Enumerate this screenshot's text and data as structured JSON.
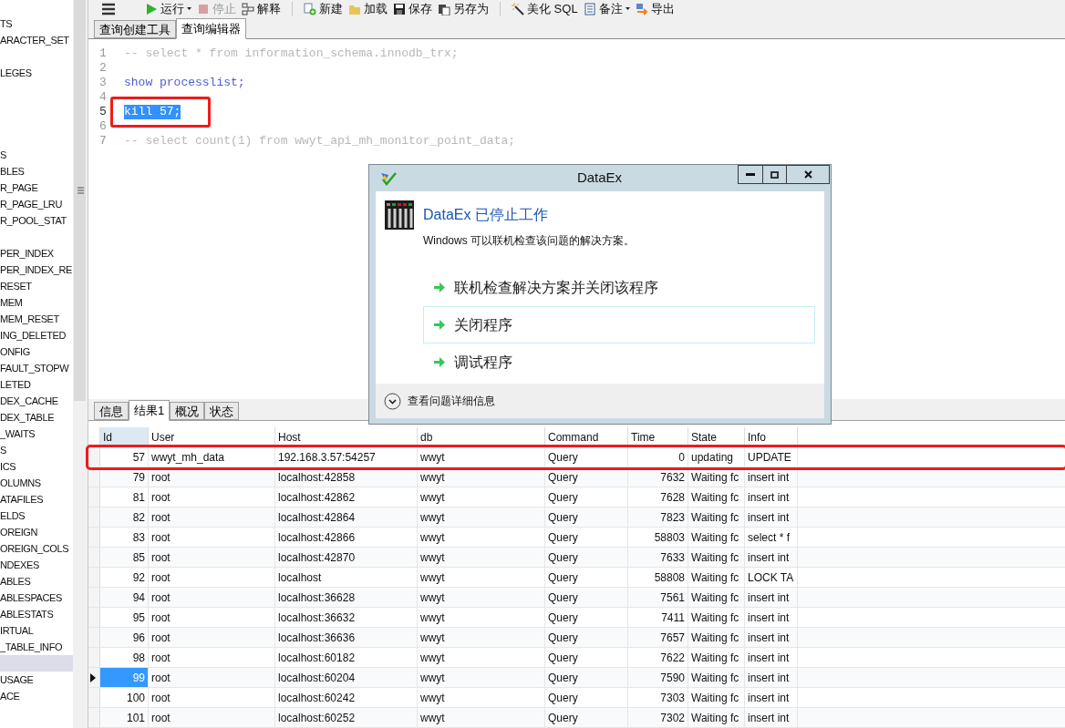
{
  "sidebar": {
    "items": [
      {
        "label": "TS",
        "selected": false
      },
      {
        "label": "ARACTER_SET",
        "selected": false
      },
      {
        "selected": false
      },
      {
        "label": "LEGES",
        "selected": false
      },
      {
        "selected": false
      },
      {
        "selected": false
      },
      {
        "selected": false
      },
      {
        "selected": false
      },
      {
        "label": "S",
        "selected": false
      },
      {
        "label": "BLES",
        "selected": false
      },
      {
        "label": "R_PAGE",
        "selected": false
      },
      {
        "label": "R_PAGE_LRU",
        "selected": false
      },
      {
        "label": "R_POOL_STAT",
        "selected": false
      },
      {
        "selected": false
      },
      {
        "label": "PER_INDEX",
        "selected": false
      },
      {
        "label": "PER_INDEX_RE",
        "selected": false
      },
      {
        "label": "RESET",
        "selected": false
      },
      {
        "label": "MEM",
        "selected": false
      },
      {
        "label": "MEM_RESET",
        "selected": false
      },
      {
        "label": "ING_DELETED",
        "selected": false
      },
      {
        "label": "ONFIG",
        "selected": false
      },
      {
        "label": "FAULT_STOPW",
        "selected": false
      },
      {
        "label": "LETED",
        "selected": false
      },
      {
        "label": "DEX_CACHE",
        "selected": false
      },
      {
        "label": "DEX_TABLE",
        "selected": false
      },
      {
        "label": "_WAITS",
        "selected": false
      },
      {
        "label": "S",
        "selected": false
      },
      {
        "label": "ICS",
        "selected": false
      },
      {
        "label": "OLUMNS",
        "selected": false
      },
      {
        "label": "ATAFILES",
        "selected": false
      },
      {
        "label": "ELDS",
        "selected": false
      },
      {
        "label": "OREIGN",
        "selected": false
      },
      {
        "label": "OREIGN_COLS",
        "selected": false
      },
      {
        "label": "NDEXES",
        "selected": false
      },
      {
        "label": "ABLES",
        "selected": false
      },
      {
        "label": "ABLESPACES",
        "selected": false
      },
      {
        "label": "ABLESTATS",
        "selected": false
      },
      {
        "label": "IRTUAL",
        "selected": false
      },
      {
        "label": "_TABLE_INFO",
        "selected": false
      },
      {
        "selected": true
      },
      {
        "label": "USAGE",
        "selected": false
      },
      {
        "label": "ACE",
        "selected": false
      }
    ]
  },
  "toolbar": {
    "groups": [
      [
        {
          "label": "运行",
          "dropdown": true,
          "disabled": false
        },
        {
          "label": "停止",
          "dropdown": false,
          "disabled": true
        },
        {
          "label": "解释",
          "dropdown": false,
          "disabled": false
        }
      ],
      [
        {
          "label": "新建",
          "dropdown": false,
          "disabled": false
        },
        {
          "label": "加载",
          "dropdown": false,
          "disabled": false
        },
        {
          "label": "保存",
          "dropdown": false,
          "disabled": false
        },
        {
          "label": "另存为",
          "dropdown": false,
          "disabled": false
        }
      ],
      [
        {
          "label": "美化 SQL",
          "dropdown": false,
          "disabled": false
        },
        {
          "label": "备注",
          "dropdown": true,
          "disabled": false
        },
        {
          "label": "导出",
          "dropdown": false,
          "disabled": false
        }
      ]
    ]
  },
  "editor": {
    "tabs": [
      {
        "label": "查询创建工具",
        "selected": false
      },
      {
        "label": "查询编辑器",
        "selected": true
      }
    ],
    "lines": [
      {
        "number": "1",
        "kind": "comment",
        "text": "-- select * from information_schema.innodb_trx;",
        "selected": false
      },
      {
        "number": "2",
        "selected": false
      },
      {
        "number": "3",
        "kind": "statement",
        "text": "show processlist;",
        "selected": false
      },
      {
        "number": "4",
        "selected": false
      },
      {
        "number": "5",
        "kind": "statement",
        "text": "kill 57;",
        "selected": true,
        "annotated": true
      },
      {
        "number": "6",
        "selected": false
      },
      {
        "number": "7",
        "kind": "comment",
        "text": "-- select count(1) from wwyt_api_mh_monitor_point_data;",
        "selected": false
      }
    ]
  },
  "results": {
    "tabs": [
      {
        "label": "信息",
        "selected": false
      },
      {
        "label": "结果1",
        "selected": true
      },
      {
        "label": "概况",
        "selected": false
      },
      {
        "label": "状态",
        "selected": false
      }
    ],
    "columns": [
      "Id",
      "User",
      "Host",
      "db",
      "Command",
      "Time",
      "State",
      "Info"
    ],
    "rows": [
      {
        "cells": [
          "57",
          "wwyt_mh_data",
          "192.168.3.57:54257",
          "wwyt",
          "Query",
          "0",
          "updating",
          "UPDATE"
        ],
        "selected": false,
        "annotated": true
      },
      {
        "cells": [
          "79",
          "root",
          "localhost:42858",
          "wwyt",
          "Query",
          "7632",
          "Waiting fc",
          "insert int"
        ],
        "selected": false
      },
      {
        "cells": [
          "81",
          "root",
          "localhost:42862",
          "wwyt",
          "Query",
          "7628",
          "Waiting fc",
          "insert int"
        ],
        "selected": false
      },
      {
        "cells": [
          "82",
          "root",
          "localhost:42864",
          "wwyt",
          "Query",
          "7823",
          "Waiting fc",
          "insert int"
        ],
        "selected": false
      },
      {
        "cells": [
          "83",
          "root",
          "localhost:42866",
          "wwyt",
          "Query",
          "58803",
          "Waiting fc",
          "select * f"
        ],
        "selected": false
      },
      {
        "cells": [
          "85",
          "root",
          "localhost:42870",
          "wwyt",
          "Query",
          "7633",
          "Waiting fc",
          "insert int"
        ],
        "selected": false
      },
      {
        "cells": [
          "92",
          "root",
          "localhost",
          "wwyt",
          "Query",
          "58808",
          "Waiting fc",
          "LOCK TA"
        ],
        "selected": false
      },
      {
        "cells": [
          "94",
          "root",
          "localhost:36628",
          "wwyt",
          "Query",
          "7561",
          "Waiting fc",
          "insert int"
        ],
        "selected": false
      },
      {
        "cells": [
          "95",
          "root",
          "localhost:36632",
          "wwyt",
          "Query",
          "7411",
          "Waiting fc",
          "insert int"
        ],
        "selected": false
      },
      {
        "cells": [
          "96",
          "root",
          "localhost:36636",
          "wwyt",
          "Query",
          "7657",
          "Waiting fc",
          "insert int"
        ],
        "selected": false
      },
      {
        "cells": [
          "98",
          "root",
          "localhost:60182",
          "wwyt",
          "Query",
          "7622",
          "Waiting fc",
          "insert int"
        ],
        "selected": false
      },
      {
        "cells": [
          "99",
          "root",
          "localhost:60204",
          "wwyt",
          "Query",
          "7590",
          "Waiting fc",
          "insert int"
        ],
        "selected": true
      },
      {
        "cells": [
          "100",
          "root",
          "localhost:60242",
          "wwyt",
          "Query",
          "7303",
          "Waiting fc",
          "insert int"
        ],
        "selected": false
      },
      {
        "cells": [
          "101",
          "root",
          "localhost:60252",
          "wwyt",
          "Query",
          "7302",
          "Waiting fc",
          "insert int"
        ],
        "selected": false
      }
    ]
  },
  "dialog": {
    "title": "DataEx",
    "heading": "DataEx 已停止工作",
    "message": "Windows 可以联机检查该问题的解决方案。",
    "options": [
      {
        "label": "联机检查解决方案并关闭该程序",
        "hovered": false
      },
      {
        "label": "关闭程序",
        "hovered": true
      },
      {
        "label": "调试程序",
        "hovered": false
      }
    ],
    "details": "查看问题详细信息"
  }
}
